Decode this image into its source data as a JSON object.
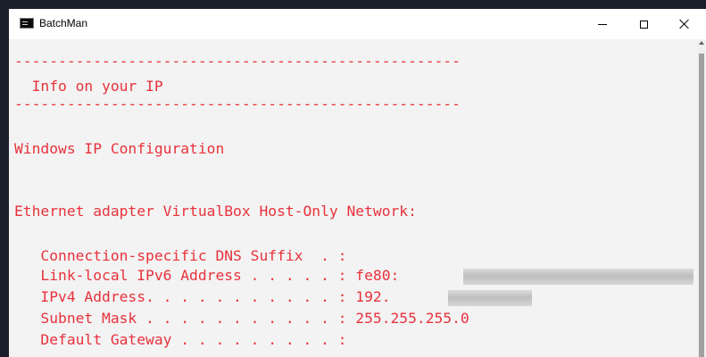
{
  "window": {
    "title": "BatchMan",
    "icon": "console-icon",
    "controls": [
      "minimize",
      "maximize",
      "close"
    ]
  },
  "console": {
    "text_color": "#e8323c",
    "background": "#f3f3f3",
    "lines": [
      "---------------------------------------------------",
      "  Info on your IP",
      "---------------------------------------------------",
      "",
      "Windows IP Configuration",
      "",
      "",
      "Ethernet adapter VirtualBox Host-Only Network:",
      "",
      "   Connection-specific DNS Suffix  . :",
      "   Link-local IPv6 Address . . . . . : fe80:",
      "   IPv4 Address. . . . . . . . . . . : 192.",
      "   Subnet Mask . . . . . . . . . . . : 255.255.255.0",
      "   Default Gateway . . . . . . . . . :"
    ]
  }
}
